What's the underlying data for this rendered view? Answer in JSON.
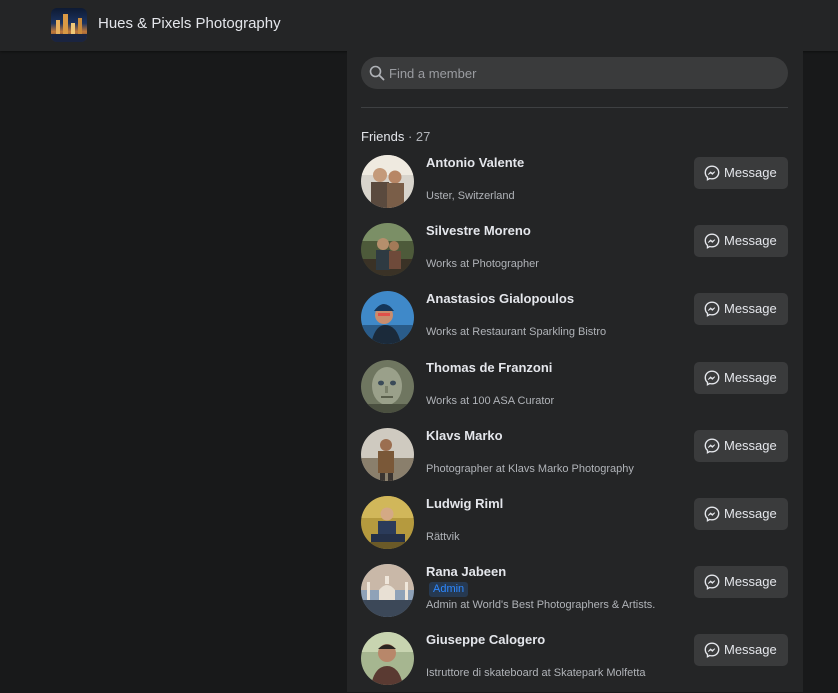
{
  "header": {
    "group_title": "Hues & Pixels Photography"
  },
  "search": {
    "placeholder": "Find a member",
    "value": ""
  },
  "section": {
    "title": "Friends",
    "count": " · 27"
  },
  "message_label": "Message",
  "members": [
    {
      "name": "Antonio Valente",
      "detail": "Uster, Switzerland",
      "badge": ""
    },
    {
      "name": "Silvestre Moreno",
      "detail": "Works at Photographer",
      "badge": ""
    },
    {
      "name": "Anastasios Gialopoulos",
      "detail": "Works at Restaurant Sparkling Bistro",
      "badge": ""
    },
    {
      "name": "Thomas de Franzoni",
      "detail": "Works at 100 ASA Curator",
      "badge": ""
    },
    {
      "name": "Klavs Marko",
      "detail": "Photographer at Klavs Marko Photography",
      "badge": ""
    },
    {
      "name": "Ludwig Riml",
      "detail": "Rättvik",
      "badge": ""
    },
    {
      "name": "Rana Jabeen",
      "detail": "Admin at World's Best Photographers & Artists.",
      "badge": "Admin"
    },
    {
      "name": "Giuseppe Calogero",
      "detail": "Istruttore di skateboard at Skatepark Molfetta",
      "badge": ""
    }
  ],
  "colors": {
    "background": "#18191a",
    "surface": "#242526",
    "button": "#3a3b3c",
    "admin_badge": "#2d88ff"
  }
}
